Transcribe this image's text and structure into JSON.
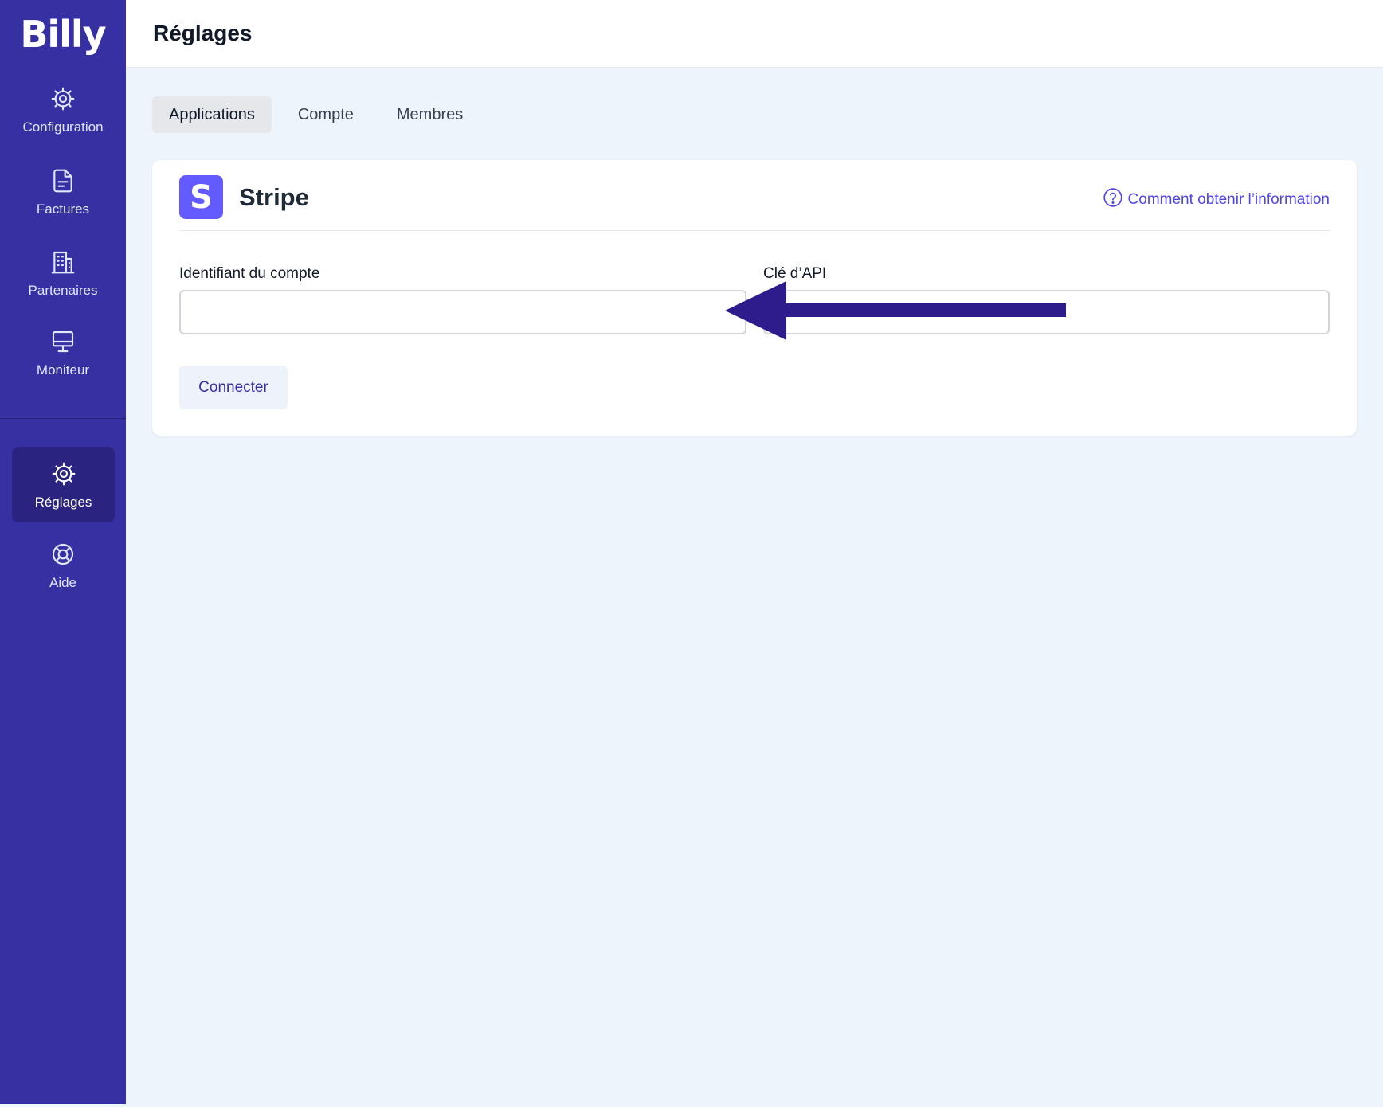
{
  "app": {
    "logo": "Billy"
  },
  "sidebar": {
    "items": [
      {
        "label": "Configuration",
        "icon": "gear-icon"
      },
      {
        "label": "Factures",
        "icon": "document-icon"
      },
      {
        "label": "Partenaires",
        "icon": "building-icon"
      },
      {
        "label": "Moniteur",
        "icon": "monitor-icon"
      },
      {
        "label": "Réglages",
        "icon": "gear-icon",
        "active": true
      },
      {
        "label": "Aide",
        "icon": "lifebuoy-icon"
      }
    ]
  },
  "header": {
    "title": "Réglages"
  },
  "tabs": [
    {
      "label": "Applications",
      "active": true
    },
    {
      "label": "Compte"
    },
    {
      "label": "Membres"
    }
  ],
  "card": {
    "logo_letter": "S",
    "title": "Stripe",
    "help_link": "Comment obtenir l’information",
    "fields": [
      {
        "label": "Identifiant du compte",
        "value": "",
        "placeholder": ""
      },
      {
        "label": "Clé d’API",
        "value": "",
        "placeholder": ""
      }
    ],
    "connect_label": "Connecter"
  },
  "colors": {
    "sidebar": "#3730a3",
    "accent": "#4f46e5",
    "stripe": "#635bff",
    "arrow": "#2e1c8c",
    "background": "#eef4fc"
  }
}
